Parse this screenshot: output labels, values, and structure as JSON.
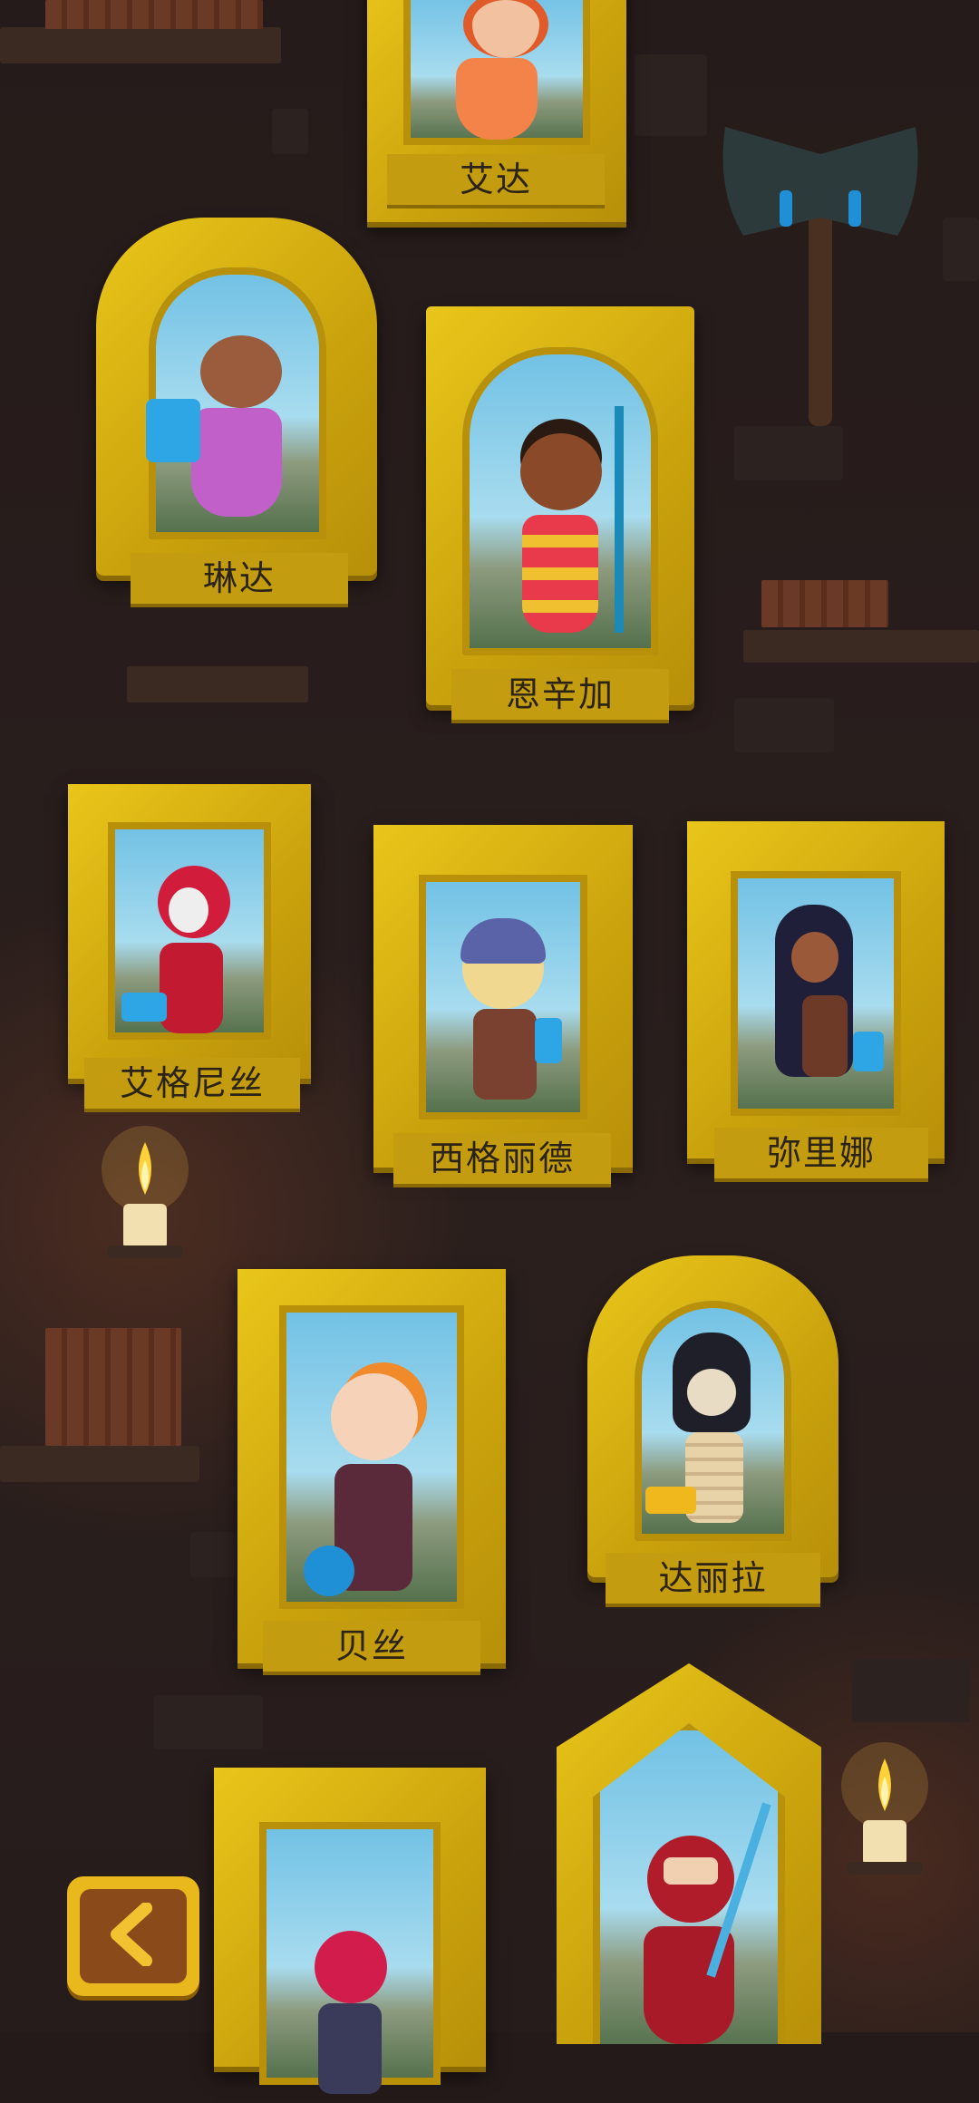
{
  "gallery": {
    "portraits": [
      {
        "name": "艾达"
      },
      {
        "name": "琳达"
      },
      {
        "name": "恩辛加"
      },
      {
        "name": "艾格尼丝"
      },
      {
        "name": "西格丽德"
      },
      {
        "name": "弥里娜"
      },
      {
        "name": "贝丝"
      },
      {
        "name": "达丽拉"
      }
    ]
  },
  "icons": {
    "back": "chevron-left-icon",
    "candle": "candle-icon",
    "axe": "axe-icon"
  },
  "colors": {
    "frame_gold": "#d6b314",
    "plate_gold": "#c39c10",
    "wall": "#231a19",
    "back_button": "#e9b81c"
  }
}
